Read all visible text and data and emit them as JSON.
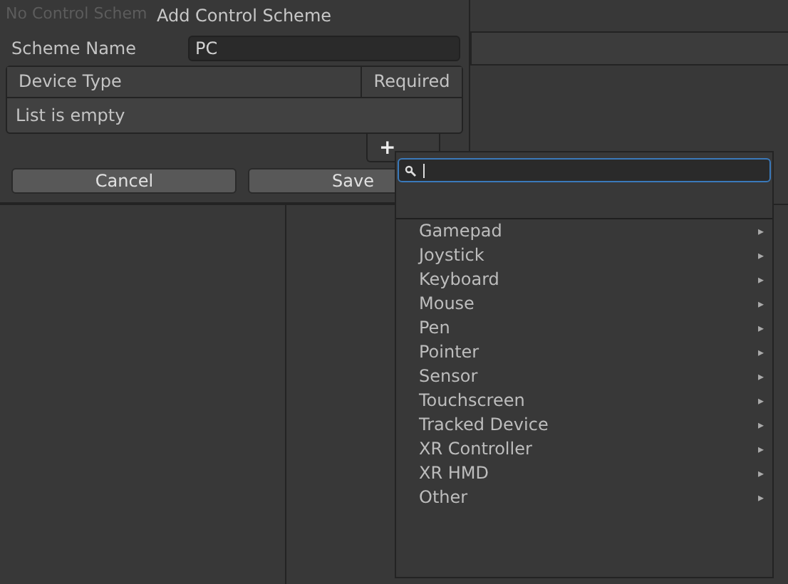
{
  "background": {
    "title": "No Control Schem"
  },
  "dialog": {
    "title": "Add Control Scheme",
    "name_label": "Scheme Name",
    "name_value": "PC",
    "table": {
      "columns": [
        "Device Type",
        "Required"
      ],
      "empty_text": "List is empty"
    },
    "add_button": "+",
    "buttons": [
      "Cancel",
      "Save"
    ]
  },
  "popup": {
    "items": [
      {
        "label": "Gamepad",
        "arrow": "▸"
      },
      {
        "label": "Joystick",
        "arrow": "▸"
      },
      {
        "label": "Keyboard",
        "arrow": "▸"
      },
      {
        "label": "Mouse",
        "arrow": "▸"
      },
      {
        "label": "Pen",
        "arrow": "▸"
      },
      {
        "label": "Pointer",
        "arrow": "▸"
      },
      {
        "label": "Sensor",
        "arrow": "▸"
      },
      {
        "label": "Touchscreen",
        "arrow": "▸"
      },
      {
        "label": "Tracked Device",
        "arrow": "▸"
      },
      {
        "label": "XR Controller",
        "arrow": "▸"
      },
      {
        "label": "XR HMD",
        "arrow": "▸"
      },
      {
        "label": "Other",
        "arrow": "▸"
      }
    ]
  }
}
